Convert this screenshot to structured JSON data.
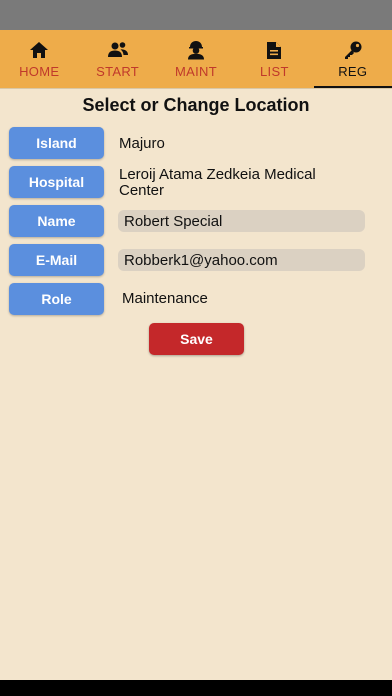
{
  "tabs": [
    {
      "label": "HOME",
      "icon": "home-icon"
    },
    {
      "label": "START",
      "icon": "users-icon"
    },
    {
      "label": "MAINT",
      "icon": "worker-icon"
    },
    {
      "label": "LIST",
      "icon": "document-icon"
    },
    {
      "label": "REG",
      "icon": "key-icon",
      "active": true
    }
  ],
  "page": {
    "title": "Select or Change Location"
  },
  "fields": {
    "island": {
      "label": "Island",
      "value": "Majuro"
    },
    "hospital": {
      "label": "Hospital",
      "value": "Leroij Atama Zedkeia Medical Center"
    },
    "name": {
      "label": "Name",
      "value": "Robert Special"
    },
    "email": {
      "label": "E-Mail",
      "value": "Robberk1@yahoo.com"
    },
    "role": {
      "label": "Role",
      "value": "Maintenance"
    }
  },
  "actions": {
    "save_label": "Save"
  },
  "colors": {
    "background": "#f3e5cd",
    "tabbar": "#eeac4a",
    "tab_label": "#c0392b",
    "field_label_bg": "#5b8fde",
    "input_bg": "#dbd1c2",
    "save_bg": "#c4282a"
  }
}
